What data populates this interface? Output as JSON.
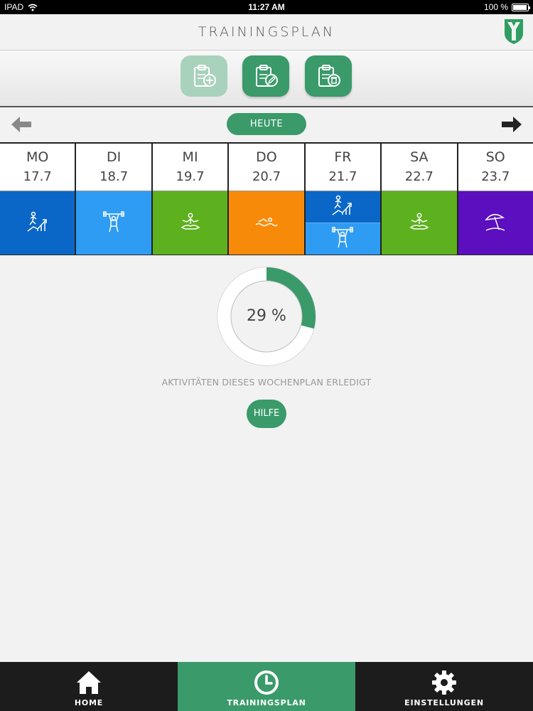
{
  "status_bar": {
    "carrier": "IPAD",
    "time": "11:27 AM",
    "battery": "100 %"
  },
  "header": {
    "title": "TRAININGSPLAN"
  },
  "toolbar": {
    "buttons": [
      {
        "icon": "clipboard-add-icon",
        "enabled": false
      },
      {
        "icon": "clipboard-edit-icon",
        "enabled": true
      },
      {
        "icon": "clipboard-delete-icon",
        "enabled": true
      }
    ]
  },
  "nav": {
    "today_label": "HEUTE"
  },
  "week": {
    "days": [
      {
        "name": "MO",
        "date": "17.7",
        "activities": [
          {
            "type": "progress-running-icon",
            "color": "#0a67c7"
          }
        ]
      },
      {
        "name": "DI",
        "date": "18.7",
        "activities": [
          {
            "type": "weightlifting-icon",
            "color": "#2f9cf4"
          }
        ]
      },
      {
        "name": "MI",
        "date": "19.7",
        "activities": [
          {
            "type": "meditation-icon",
            "color": "#5db01e"
          }
        ]
      },
      {
        "name": "DO",
        "date": "20.7",
        "activities": [
          {
            "type": "swimming-icon",
            "color": "#f88a0a"
          }
        ]
      },
      {
        "name": "FR",
        "date": "21.7",
        "activities": [
          {
            "type": "progress-running-icon",
            "color": "#0a67c7"
          },
          {
            "type": "weightlifting-icon",
            "color": "#2f9cf4"
          }
        ]
      },
      {
        "name": "SA",
        "date": "22.7",
        "activities": [
          {
            "type": "meditation-icon",
            "color": "#5db01e"
          }
        ]
      },
      {
        "name": "SO",
        "date": "23.7",
        "activities": [
          {
            "type": "beach-rest-icon",
            "color": "#5b0fbe"
          }
        ]
      }
    ]
  },
  "progress": {
    "value": 29,
    "label": "29 %",
    "caption": "AKTIVITÄTEN DIESES WOCHENPLAN ERLEDIGT",
    "color": "#3a9a6a"
  },
  "help": {
    "label": "HILFE"
  },
  "tabbar": {
    "tabs": [
      {
        "label": "HOME",
        "icon": "home-icon",
        "active": false
      },
      {
        "label": "TRAININGSPLAN",
        "icon": "clock-icon",
        "active": true
      },
      {
        "label": "EINSTELLUNGEN",
        "icon": "gear-icon",
        "active": false
      }
    ]
  },
  "colors": {
    "accent": "#3a9a6a",
    "background": "#f2f2f2"
  }
}
